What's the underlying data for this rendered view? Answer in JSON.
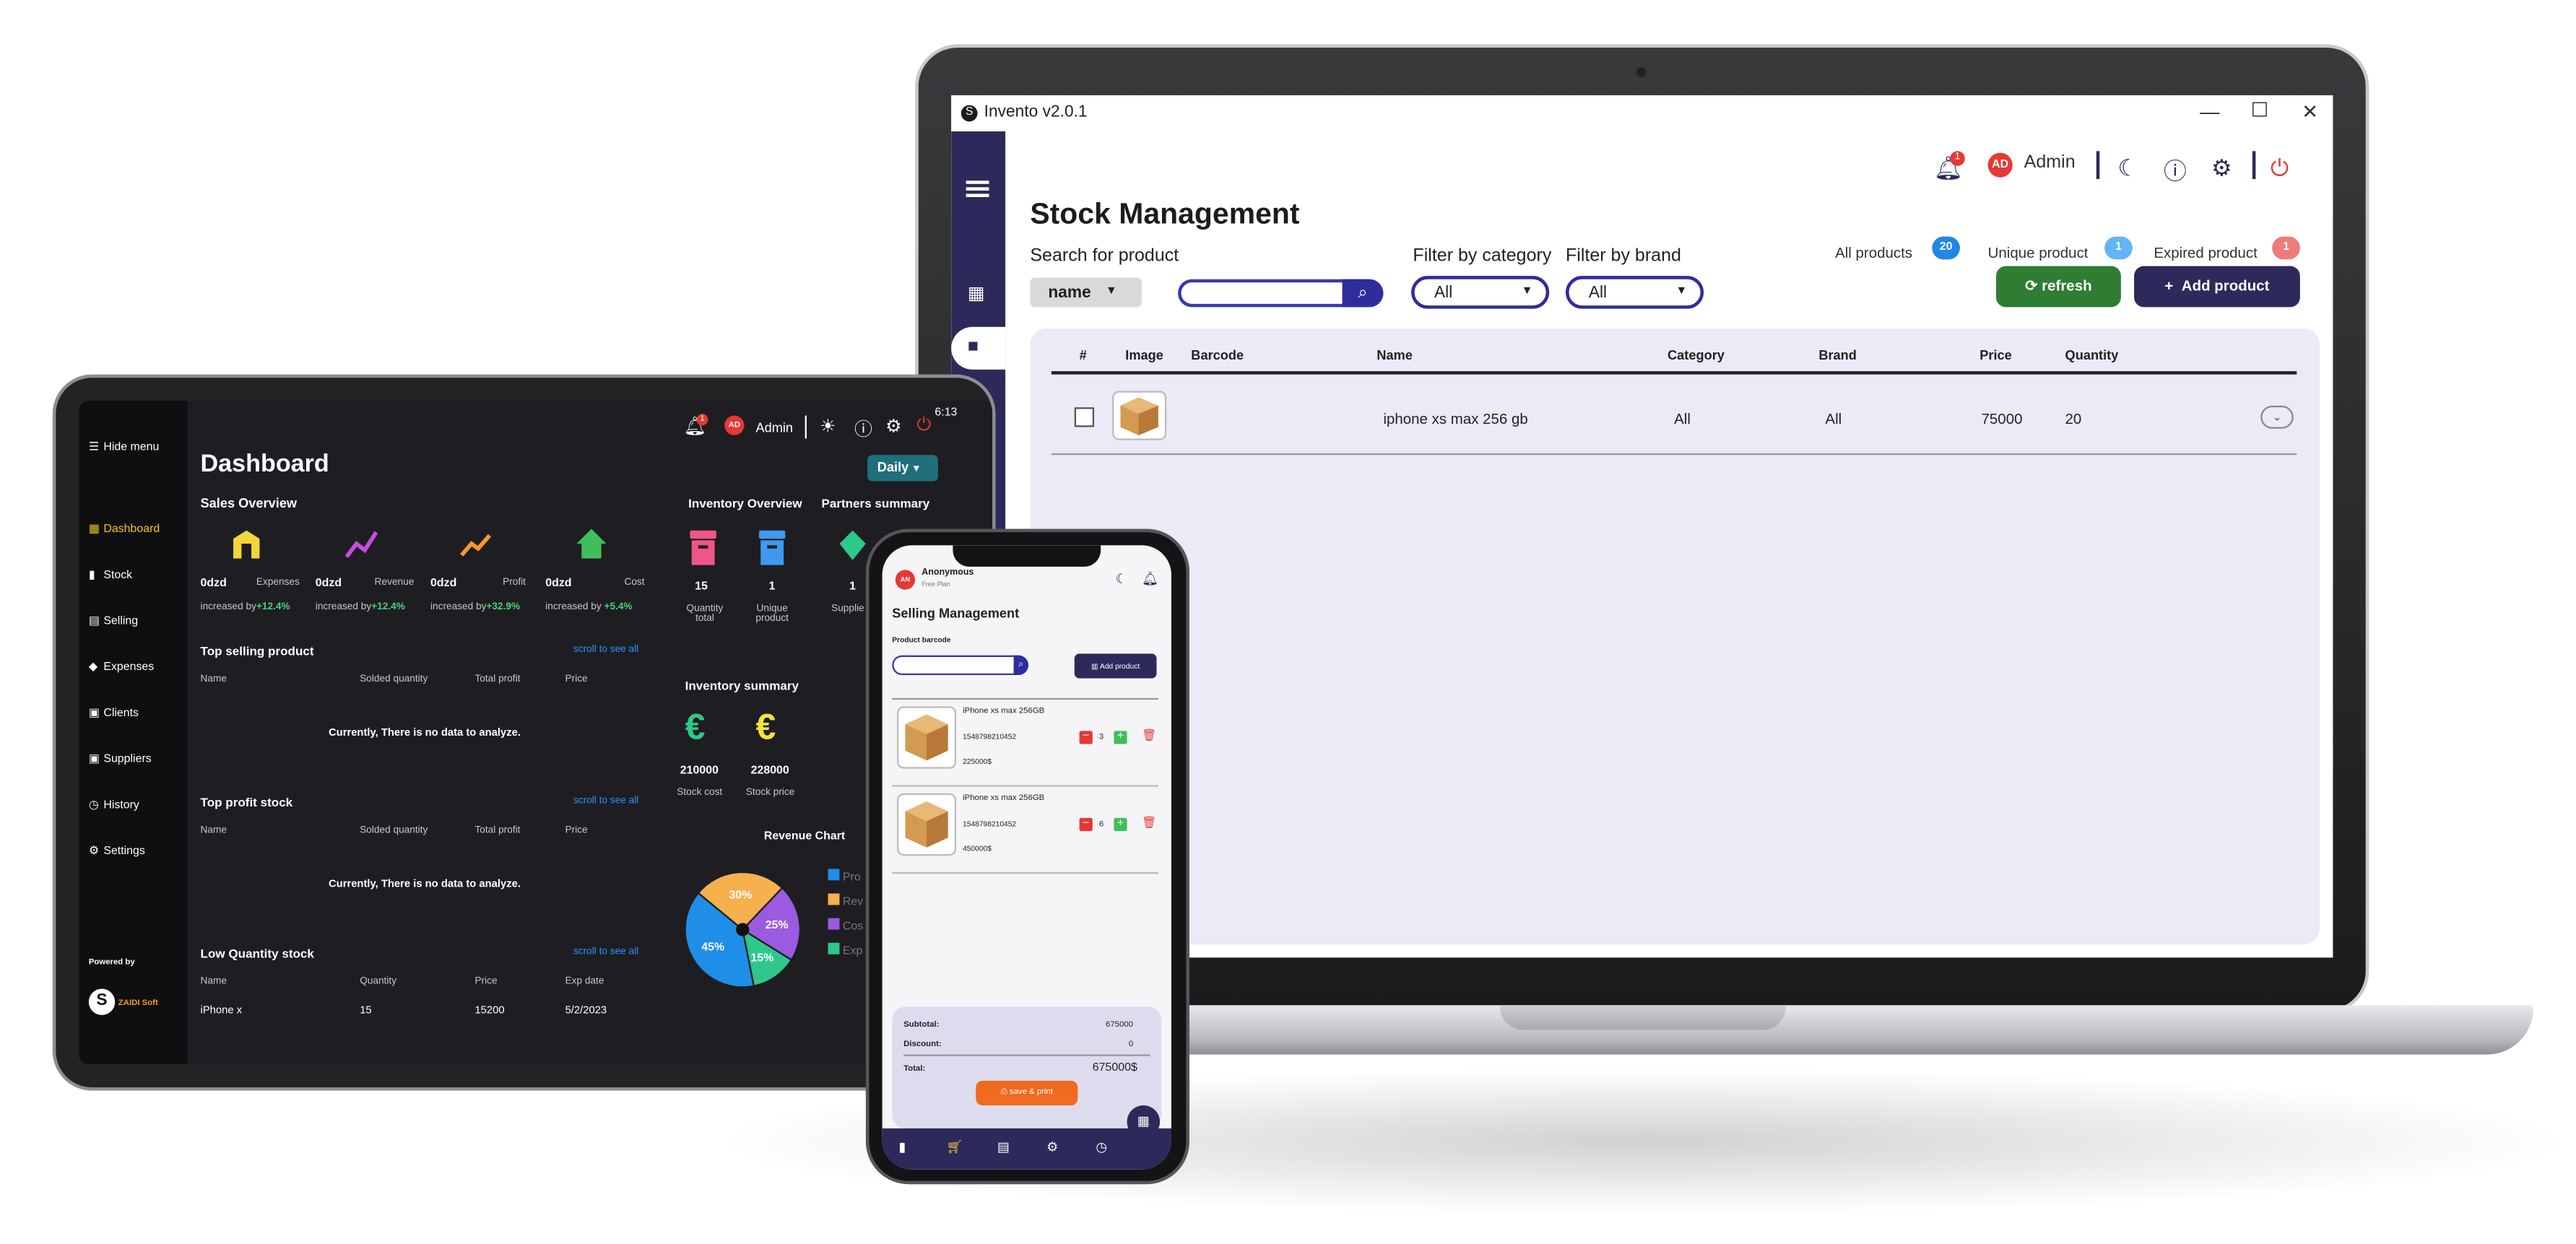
{
  "desktop": {
    "window_title": "Invento v2.0.1",
    "user": {
      "initials": "AD",
      "name": "Admin",
      "notif_count": "1"
    },
    "page_title": "Stock Management",
    "stats": [
      {
        "label": "All products",
        "count": "20",
        "color": "#1e88e5"
      },
      {
        "label": "Unique product",
        "count": "1",
        "color": "#64b5f6"
      },
      {
        "label": "Expired product",
        "count": "1",
        "color": "#ef7b7b"
      }
    ],
    "search": {
      "label": "Search for product",
      "mode": "name",
      "value": ""
    },
    "filters": [
      {
        "label": "Filter by category",
        "value": "All"
      },
      {
        "label": "Filter by brand",
        "value": "All"
      }
    ],
    "buttons": {
      "refresh": "refresh",
      "add": "Add product"
    },
    "table": {
      "headers": [
        "#",
        "Image",
        "Barcode",
        "Name",
        "Category",
        "Brand",
        "Price",
        "Quantity"
      ],
      "rows": [
        {
          "name": "iphone xs max 256 gb",
          "category": "All",
          "brand": "All",
          "price": "75000",
          "quantity": "20"
        }
      ]
    }
  },
  "tablet": {
    "status": {
      "time": "6:13"
    },
    "hide_menu": "Hide menu",
    "user": {
      "initials": "AD",
      "name": "Admin",
      "notif_count": "1"
    },
    "nav": [
      "Dashboard",
      "Stock",
      "Selling",
      "Expenses",
      "Clients",
      "Suppliers",
      "History",
      "Settings"
    ],
    "powered_by": "Powered by",
    "brand": "ZAIDI Soft",
    "title": "Dashboard",
    "period": "Daily",
    "sales_overview": {
      "title": "Sales Overview",
      "cards": [
        {
          "value": "0dzd",
          "label": "Expenses",
          "trend_prefix": "increased by",
          "trend": "+12.4%",
          "color": "#f5d63a"
        },
        {
          "value": "0dzd",
          "label": "Revenue",
          "trend_prefix": "increased by",
          "trend": "+12.4%",
          "color": "#c64de0"
        },
        {
          "value": "0dzd",
          "label": "Profit",
          "trend_prefix": "increased by",
          "trend": "+32.9%",
          "color": "#f39a2b"
        },
        {
          "value": "0dzd",
          "label": "Cost",
          "trend_prefix": "increased by",
          "trend": "+5.4%",
          "color": "#3fbf5a"
        }
      ]
    },
    "top_selling": {
      "title": "Top selling product",
      "link": "scroll to see all",
      "headers": [
        "Name",
        "Solded quantity",
        "Total profit",
        "Price"
      ],
      "empty": "Currently, There is no data to analyze."
    },
    "top_profit": {
      "title": "Top profit stock",
      "link": "scroll to see all",
      "headers": [
        "Name",
        "Solded quantity",
        "Total profit",
        "Price"
      ],
      "empty": "Currently, There is no data to analyze."
    },
    "low_quantity": {
      "title": "Low Quantity stock",
      "link": "scroll to see all",
      "headers": [
        "Name",
        "Quantity",
        "Price",
        "Exp date"
      ],
      "row": [
        "iPhone x",
        "15",
        "15200",
        "5/2/2023"
      ]
    },
    "inventory_overview": {
      "title": "Inventory Overview",
      "items": [
        {
          "value": "15",
          "label1": "Quantity",
          "label2": "total"
        },
        {
          "value": "1",
          "label1": "Unique",
          "label2": "product"
        }
      ]
    },
    "partners": {
      "title": "Partners summary",
      "value": "1",
      "label": "Supplie"
    },
    "inventory_summary": {
      "title": "Inventory summary",
      "items": [
        {
          "value": "210000",
          "label": "Stock cost"
        },
        {
          "value": "228000",
          "label": "Stock price"
        }
      ]
    },
    "revenue_chart": {
      "title": "Revenue Chart",
      "legend": [
        "Pro",
        "Rev",
        "Cos",
        "Exp"
      ]
    }
  },
  "chart_data": {
    "type": "pie",
    "title": "Revenue Chart",
    "slices": [
      {
        "label": "45%",
        "value": 45,
        "color": "#1e8ee6"
      },
      {
        "label": "30%",
        "value": 30,
        "color": "#f7b04e"
      },
      {
        "label": "25%",
        "value": 25,
        "color": "#9a5be0"
      },
      {
        "label": "15%",
        "value": 15,
        "color": "#2ec88a"
      }
    ],
    "legend": [
      "Pro",
      "Rev",
      "Cos",
      "Exp"
    ]
  },
  "phone": {
    "user": {
      "initials": "AN",
      "name": "Anonymous",
      "plan": "Free Plan"
    },
    "title": "Selling Management",
    "barcode_label": "Product barcode",
    "add_button": "Add product",
    "items": [
      {
        "name": "iPhone xs max 256GB",
        "barcode": "1548798210452",
        "price": "225000$",
        "qty": "3"
      },
      {
        "name": "iPhone xs max 256GB",
        "barcode": "1548798210452",
        "price": "450000$",
        "qty": "6"
      }
    ],
    "summary": {
      "subtotal_label": "Subtotal:",
      "subtotal": "675000",
      "discount_label": "Discount:",
      "discount": "0",
      "total_label": "Total:",
      "total": "675000$"
    },
    "save_button": "save & print"
  }
}
